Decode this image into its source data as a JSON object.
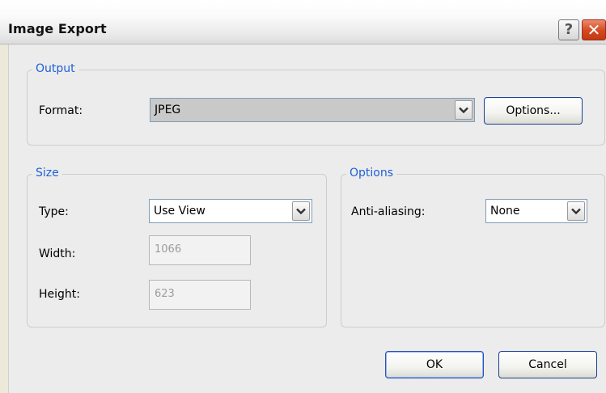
{
  "window": {
    "title": "Image Export",
    "help_glyph": "?",
    "close_glyph": "✕"
  },
  "output": {
    "legend": "Output",
    "format_label": "Format:",
    "format_value": "JPEG",
    "options_button": "Options..."
  },
  "size": {
    "legend": "Size",
    "type_label": "Type:",
    "type_value": "Use View",
    "width_label": "Width:",
    "width_value": "1066",
    "height_label": "Height:",
    "height_value": "623"
  },
  "options": {
    "legend": "Options",
    "antialias_label": "Anti-aliasing:",
    "antialias_value": "None"
  },
  "footer": {
    "ok_label": "OK",
    "cancel_label": "Cancel"
  },
  "colors": {
    "legend_text": "#1f5fd8",
    "close_button": "#d4481f",
    "button_border": "#1c3f94"
  },
  "icons": {
    "help": "help-icon",
    "close": "close-icon",
    "dropdown": "chevron-down-icon"
  }
}
